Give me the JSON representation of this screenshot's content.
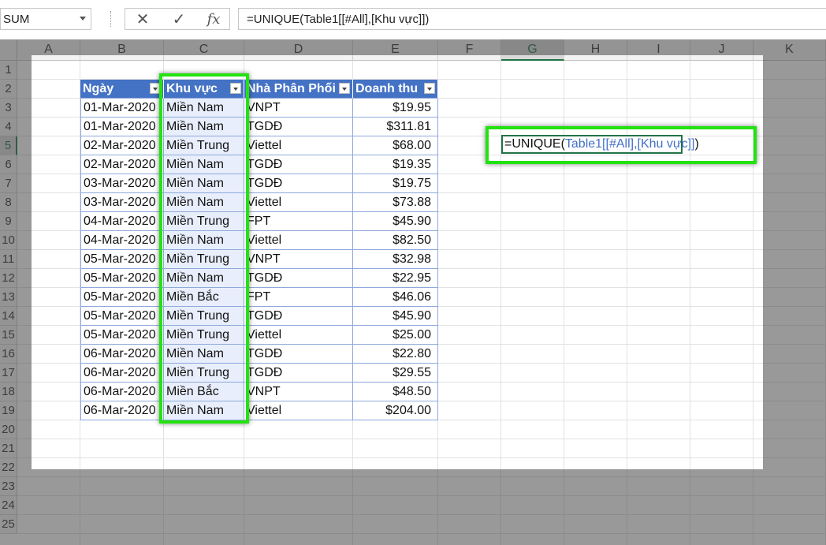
{
  "formula_bar": {
    "name_box": "SUM",
    "cancel_icon": "✕",
    "enter_icon": "✓",
    "fx_label": "fx",
    "formula": "=UNIQUE(Table1[[#All],[Khu vực]])"
  },
  "columns": [
    "A",
    "B",
    "C",
    "D",
    "E",
    "F",
    "G",
    "H",
    "I",
    "J",
    "K"
  ],
  "rows": [
    "1",
    "2",
    "3",
    "4",
    "5",
    "6",
    "7",
    "8",
    "9",
    "10",
    "11",
    "12",
    "13",
    "14",
    "15",
    "16",
    "17",
    "18",
    "19",
    "20",
    "21",
    "22",
    "23",
    "24",
    "25"
  ],
  "table": {
    "headers": [
      "Ngày",
      "Khu vực",
      "Nhà Phân Phối",
      "Doanh thu"
    ],
    "rows": [
      [
        "01-Mar-2020",
        "Miền Nam",
        "VNPT",
        "$19.95"
      ],
      [
        "01-Mar-2020",
        "Miền Nam",
        "TGDĐ",
        "$311.81"
      ],
      [
        "02-Mar-2020",
        "Miền Trung",
        "Viettel",
        "$68.00"
      ],
      [
        "02-Mar-2020",
        "Miền Nam",
        "TGDĐ",
        "$19.35"
      ],
      [
        "03-Mar-2020",
        "Miền Nam",
        "TGDĐ",
        "$19.75"
      ],
      [
        "03-Mar-2020",
        "Miền Nam",
        "Viettel",
        "$73.88"
      ],
      [
        "04-Mar-2020",
        "Miền Trung",
        "FPT",
        "$45.90"
      ],
      [
        "04-Mar-2020",
        "Miền Nam",
        "Viettel",
        "$82.50"
      ],
      [
        "05-Mar-2020",
        "Miền Trung",
        "VNPT",
        "$32.98"
      ],
      [
        "05-Mar-2020",
        "Miền Nam",
        "TGDĐ",
        "$22.95"
      ],
      [
        "05-Mar-2020",
        "Miền Bắc",
        "FPT",
        "$46.06"
      ],
      [
        "05-Mar-2020",
        "Miền Trung",
        "TGDĐ",
        "$45.90"
      ],
      [
        "05-Mar-2020",
        "Miền Trung",
        "Viettel",
        "$25.00"
      ],
      [
        "06-Mar-2020",
        "Miền Nam",
        "TGDĐ",
        "$22.80"
      ],
      [
        "06-Mar-2020",
        "Miền Trung",
        "TGDĐ",
        "$29.55"
      ],
      [
        "06-Mar-2020",
        "Miền Bắc",
        "VNPT",
        "$48.50"
      ],
      [
        "06-Mar-2020",
        "Miền Nam",
        "Viettel",
        "$204.00"
      ]
    ]
  },
  "edit_cell": {
    "func": "=UNIQUE(",
    "ref": "Table1[[#All],[Khu vực]]",
    "close": ")"
  },
  "colors": {
    "header_blue": "#4472c4",
    "highlight_green": "#22e30f",
    "excel_green": "#217346"
  },
  "active_cell": "G5"
}
